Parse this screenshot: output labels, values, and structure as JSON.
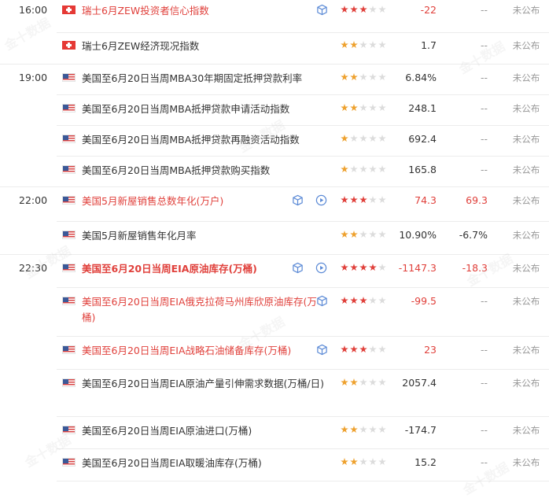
{
  "watermark": "金十数据",
  "actual_label": "未公布",
  "rows": [
    {
      "time": "16:00",
      "flag": "CH",
      "title": "瑞士6月ZEW投资者信心指数",
      "red": true,
      "bold": false,
      "icons": [
        "cube"
      ],
      "stars": 3,
      "prev": "-22",
      "forecast": "--",
      "actual": "未公布"
    },
    {
      "time": "",
      "flag": "CH",
      "title": "瑞士6月ZEW经济现况指数",
      "red": false,
      "bold": false,
      "icons": [],
      "stars": 2,
      "prev": "1.7",
      "forecast": "--",
      "actual": "未公布"
    },
    {
      "time": "19:00",
      "flag": "US",
      "title": "美国至6月20日当周MBA30年期固定抵押贷款利率",
      "red": false,
      "bold": false,
      "icons": [],
      "stars": 2,
      "prev": "6.84%",
      "forecast": "--",
      "actual": "未公布"
    },
    {
      "time": "",
      "flag": "US",
      "title": "美国至6月20日当周MBA抵押贷款申请活动指数",
      "red": false,
      "bold": false,
      "icons": [],
      "stars": 2,
      "prev": "248.1",
      "forecast": "--",
      "actual": "未公布"
    },
    {
      "time": "",
      "flag": "US",
      "title": "美国至6月20日当周MBA抵押贷款再融资活动指数",
      "red": false,
      "bold": false,
      "icons": [],
      "stars": 1,
      "prev": "692.4",
      "forecast": "--",
      "actual": "未公布"
    },
    {
      "time": "",
      "flag": "US",
      "title": "美国至6月20日当周MBA抵押贷款购买指数",
      "red": false,
      "bold": false,
      "icons": [],
      "stars": 1,
      "prev": "165.8",
      "forecast": "--",
      "actual": "未公布"
    },
    {
      "time": "22:00",
      "flag": "US",
      "title": "美国5月新屋销售总数年化(万户)",
      "red": true,
      "bold": false,
      "icons": [
        "cube",
        "play"
      ],
      "stars": 3,
      "prev": "74.3",
      "forecast": "69.3",
      "actual": "未公布"
    },
    {
      "time": "",
      "flag": "US",
      "title": "美国5月新屋销售年化月率",
      "red": false,
      "bold": false,
      "icons": [],
      "stars": 2,
      "prev": "10.90%",
      "forecast": "-6.7%",
      "actual": "未公布"
    },
    {
      "time": "22:30",
      "flag": "US",
      "title": "美国至6月20日当周EIA原油库存(万桶)",
      "red": true,
      "bold": true,
      "icons": [
        "cube",
        "play"
      ],
      "stars": 4,
      "prev": "-1147.3",
      "forecast": "-18.3",
      "actual": "未公布"
    },
    {
      "time": "",
      "flag": "US",
      "title": "美国至6月20日当周EIA俄克拉荷马州库欣原油库存(万桶)",
      "red": true,
      "bold": false,
      "icons": [
        "cube"
      ],
      "stars": 3,
      "prev": "-99.5",
      "forecast": "--",
      "actual": "未公布"
    },
    {
      "time": "",
      "flag": "US",
      "title": "美国至6月20日当周EIA战略石油储备库存(万桶)",
      "red": true,
      "bold": false,
      "icons": [
        "cube"
      ],
      "stars": 3,
      "prev": "23",
      "forecast": "--",
      "actual": "未公布"
    },
    {
      "time": "",
      "flag": "US",
      "title": "美国至6月20日当周EIA原油产量引伸需求数据(万桶/日)",
      "red": false,
      "bold": false,
      "icons": [],
      "stars": 2,
      "prev": "2057.4",
      "forecast": "--",
      "actual": "未公布"
    },
    {
      "time": "",
      "flag": "US",
      "title": "美国至6月20日当周EIA原油进口(万桶)",
      "red": false,
      "bold": false,
      "icons": [],
      "stars": 2,
      "prev": "-174.7",
      "forecast": "--",
      "actual": "未公布"
    },
    {
      "time": "",
      "flag": "US",
      "title": "美国至6月20日当周EIA取暖油库存(万桶)",
      "red": false,
      "bold": false,
      "icons": [],
      "stars": 2,
      "prev": "15.2",
      "forecast": "--",
      "actual": "未公布"
    }
  ]
}
